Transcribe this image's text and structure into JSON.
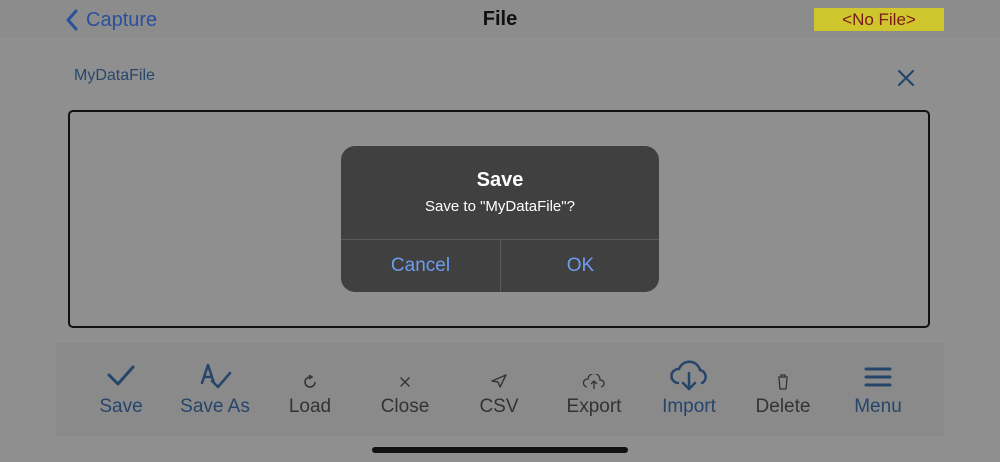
{
  "nav": {
    "back_label": "Capture",
    "title": "File",
    "file_badge": "<No File>"
  },
  "file": {
    "name": "MyDataFile"
  },
  "toolbar": {
    "items": [
      {
        "label": "Save",
        "icon": "checkmark-icon"
      },
      {
        "label": "Save As",
        "icon": "save-as-icon"
      },
      {
        "label": "Load",
        "icon": "reload-icon"
      },
      {
        "label": "Close",
        "icon": "close-icon"
      },
      {
        "label": "CSV",
        "icon": "send-icon"
      },
      {
        "label": "Export",
        "icon": "cloud-upload-icon"
      },
      {
        "label": "Import",
        "icon": "cloud-download-icon"
      },
      {
        "label": "Delete",
        "icon": "trash-icon"
      },
      {
        "label": "Menu",
        "icon": "hamburger-menu-icon"
      }
    ]
  },
  "alert": {
    "title": "Save",
    "message": "Save to \"MyDataFile\"?",
    "cancel_label": "Cancel",
    "ok_label": "OK"
  },
  "colors": {
    "accent": "#26456b",
    "link": "#2a4f9e",
    "badge_bg": "#cfc52c",
    "badge_text": "#7a1a1a",
    "alert_button": "#6d9cf0"
  }
}
